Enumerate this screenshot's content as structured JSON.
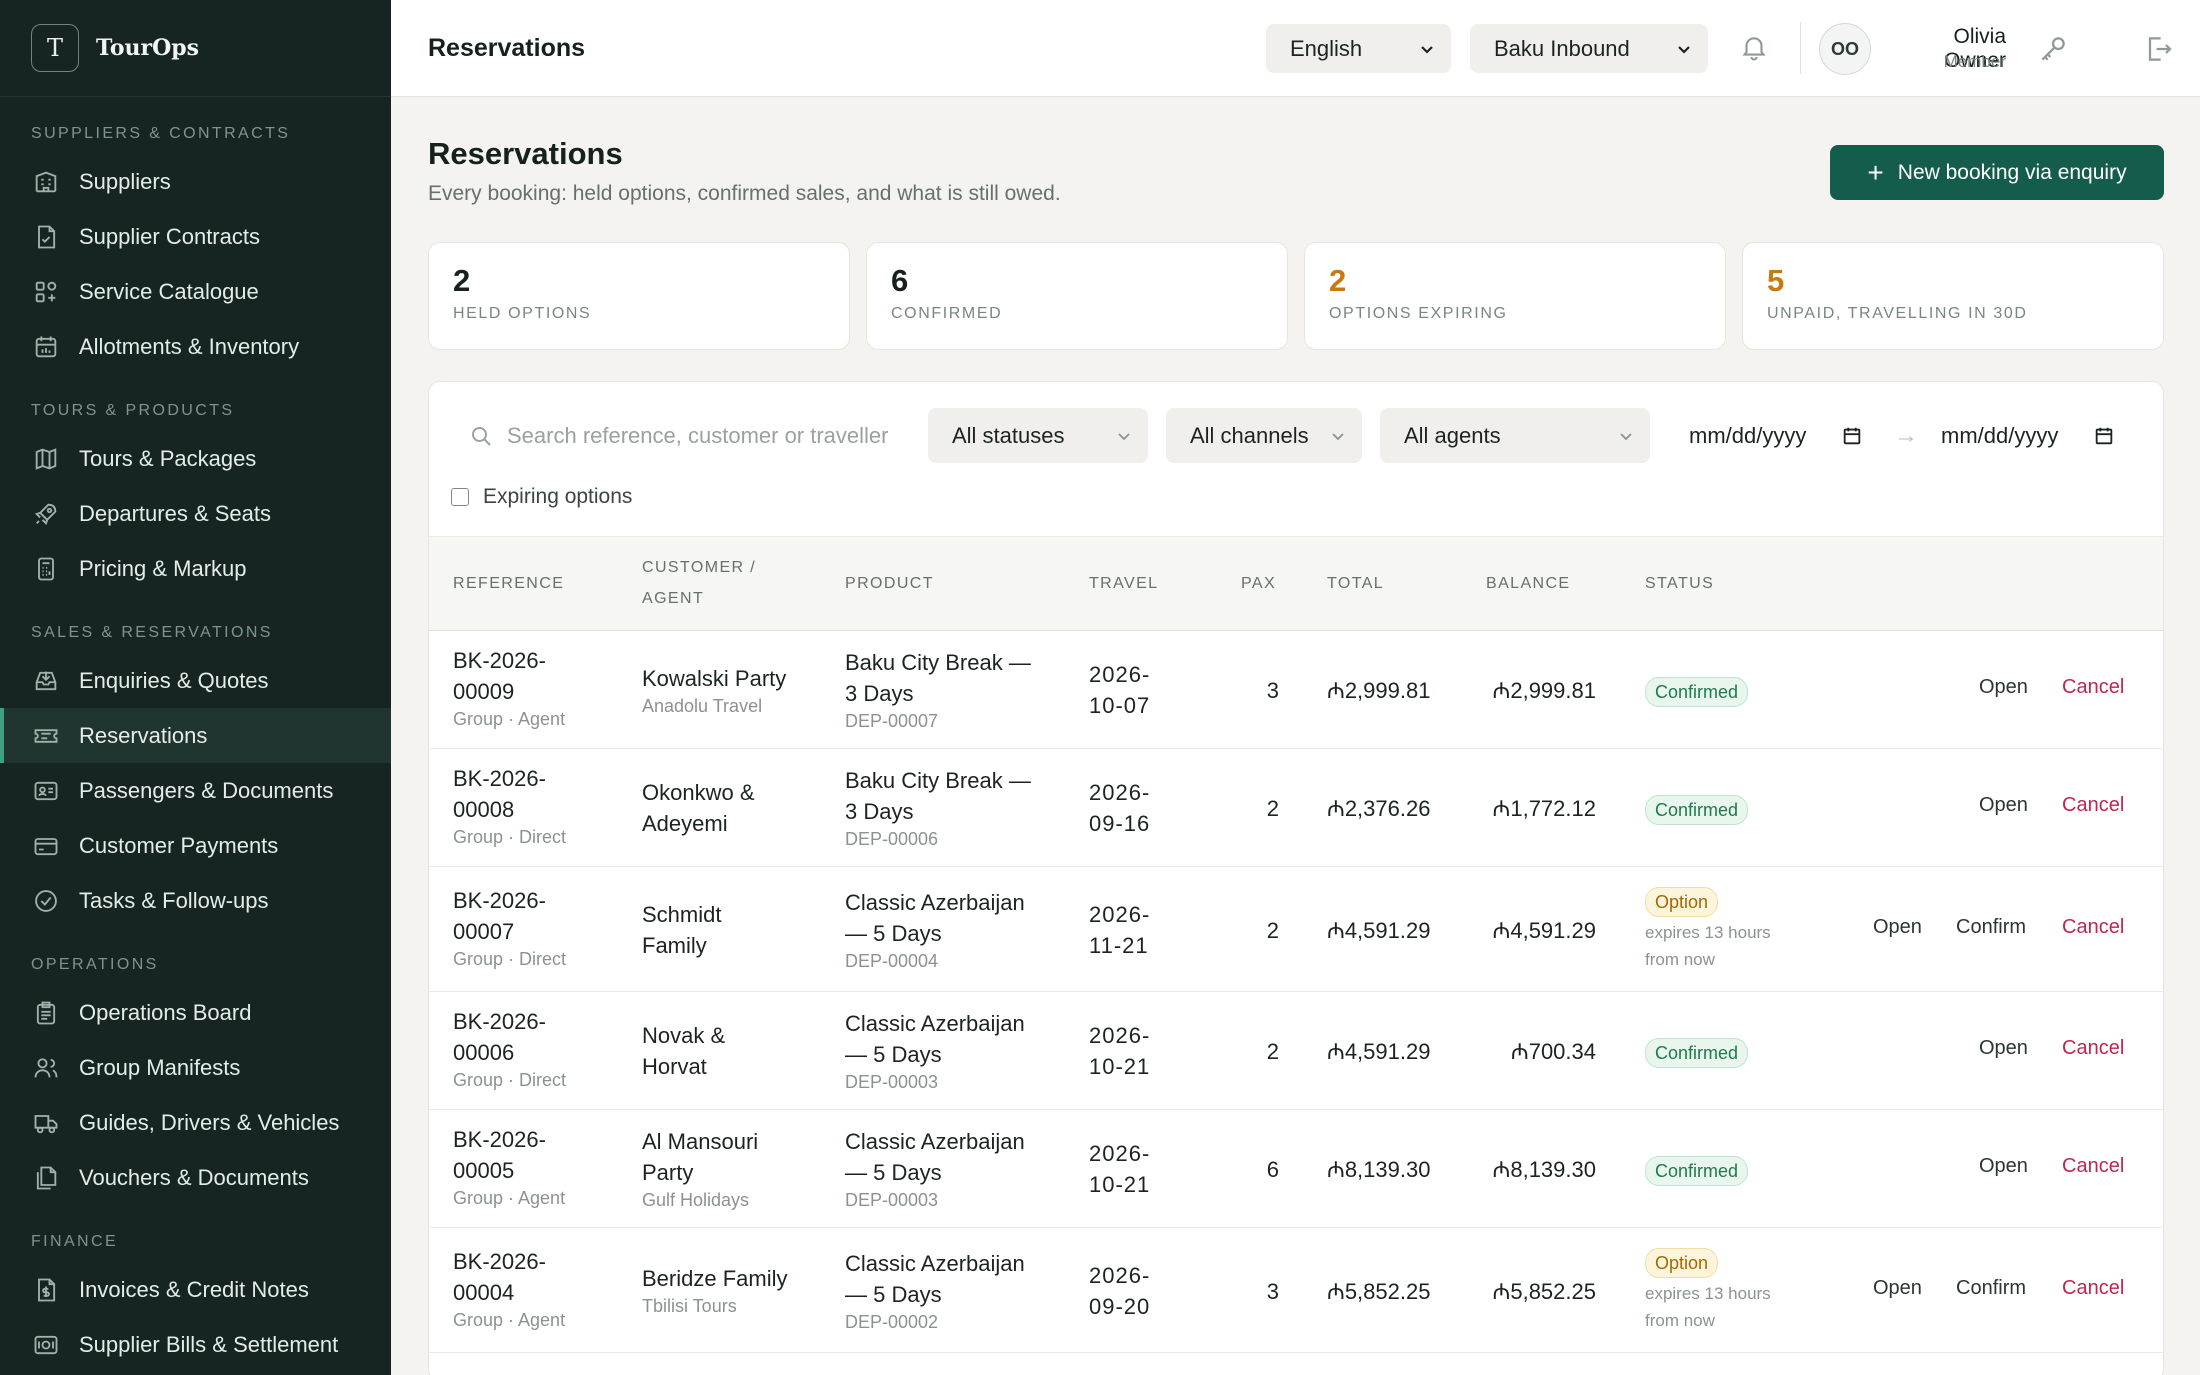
{
  "brand": {
    "logo_letter": "T",
    "name": "TourOps"
  },
  "sidebar": {
    "sections": [
      {
        "title": "SUPPLIERS & CONTRACTS",
        "items": [
          {
            "label": "Suppliers",
            "icon": "building-icon"
          },
          {
            "label": "Supplier Contracts",
            "icon": "contract-icon"
          },
          {
            "label": "Service Catalogue",
            "icon": "grid-icon"
          },
          {
            "label": "Allotments & Inventory",
            "icon": "calendar-icon"
          }
        ]
      },
      {
        "title": "TOURS & PRODUCTS",
        "items": [
          {
            "label": "Tours & Packages",
            "icon": "map-icon"
          },
          {
            "label": "Departures & Seats",
            "icon": "rocket-icon"
          },
          {
            "label": "Pricing & Markup",
            "icon": "calculator-icon"
          }
        ]
      },
      {
        "title": "SALES & RESERVATIONS",
        "items": [
          {
            "label": "Enquiries & Quotes",
            "icon": "inbox-icon"
          },
          {
            "label": "Reservations",
            "icon": "ticket-icon",
            "active": true
          },
          {
            "label": "Passengers & Documents",
            "icon": "id-card-icon"
          },
          {
            "label": "Customer Payments",
            "icon": "credit-card-icon"
          },
          {
            "label": "Tasks & Follow-ups",
            "icon": "check-circle-icon"
          }
        ]
      },
      {
        "title": "OPERATIONS",
        "items": [
          {
            "label": "Operations Board",
            "icon": "clipboard-icon"
          },
          {
            "label": "Group Manifests",
            "icon": "users-icon"
          },
          {
            "label": "Guides, Drivers & Vehicles",
            "icon": "truck-icon"
          },
          {
            "label": "Vouchers & Documents",
            "icon": "documents-icon"
          }
        ]
      },
      {
        "title": "FINANCE",
        "items": [
          {
            "label": "Invoices & Credit Notes",
            "icon": "invoice-icon"
          },
          {
            "label": "Supplier Bills & Settlement",
            "icon": "bill-icon"
          }
        ]
      }
    ]
  },
  "topbar": {
    "title": "Reservations",
    "language": "English",
    "agency": "Baku Inbound",
    "user": {
      "initials": "OO",
      "name": "Olivia Owner",
      "role": "Member"
    }
  },
  "page": {
    "heading": "Reservations",
    "subheading": "Every booking: held options, confirmed sales, and what is still owed.",
    "new_button": "New booking via enquiry"
  },
  "stats": [
    {
      "value": "2",
      "label": "HELD OPTIONS",
      "color": "#16211e"
    },
    {
      "value": "6",
      "label": "CONFIRMED",
      "color": "#16211e"
    },
    {
      "value": "2",
      "label": "OPTIONS EXPIRING",
      "color": "#c77a10"
    },
    {
      "value": "5",
      "label": "UNPAID, TRAVELLING IN 30D",
      "color": "#c77a10"
    }
  ],
  "filters": {
    "search_placeholder": "Search reference, customer or traveller",
    "status": "All statuses",
    "channel": "All channels",
    "agent": "All agents",
    "date_from": "mm/dd/yyyy",
    "date_to": "mm/dd/yyyy",
    "arrow": "→",
    "expiring_label": "Expiring options"
  },
  "table": {
    "headers": {
      "reference": "REFERENCE",
      "customer_1": "CUSTOMER /",
      "customer_2": "AGENT",
      "product": "PRODUCT",
      "travel": "TRAVEL",
      "pax": "PAX",
      "total": "TOTAL",
      "balance": "BALANCE",
      "status": "STATUS"
    },
    "actions": {
      "open": "Open",
      "confirm": "Confirm",
      "cancel": "Cancel"
    },
    "rows": [
      {
        "ref1": "BK-2026-",
        "ref2": "00009",
        "type": "Group · Agent",
        "cust1": "Kowalski Party",
        "cust2": "",
        "agent": "Anadolu Travel",
        "prod1": "Baku City Break —",
        "prod2": "3 Days",
        "dep": "DEP-00007",
        "travel1": "2026-",
        "travel2": "10-07",
        "pax": "3",
        "total": "₼2,999.81",
        "balance": "₼2,999.81",
        "status": "Confirmed",
        "expires1": "",
        "expires2": ""
      },
      {
        "ref1": "BK-2026-",
        "ref2": "00008",
        "type": "Group · Direct",
        "cust1": "Okonkwo &",
        "cust2": "Adeyemi",
        "agent": "",
        "prod1": "Baku City Break —",
        "prod2": "3 Days",
        "dep": "DEP-00006",
        "travel1": "2026-",
        "travel2": "09-16",
        "pax": "2",
        "total": "₼2,376.26",
        "balance": "₼1,772.12",
        "status": "Confirmed",
        "expires1": "",
        "expires2": ""
      },
      {
        "ref1": "BK-2026-",
        "ref2": "00007",
        "type": "Group · Direct",
        "cust1": "Schmidt",
        "cust2": "Family",
        "agent": "",
        "prod1": "Classic Azerbaijan",
        "prod2": "— 5 Days",
        "dep": "DEP-00004",
        "travel1": "2026-",
        "travel2": "11-21",
        "pax": "2",
        "total": "₼4,591.29",
        "balance": "₼4,591.29",
        "status": "Option",
        "expires1": "expires 13 hours",
        "expires2": "from now"
      },
      {
        "ref1": "BK-2026-",
        "ref2": "00006",
        "type": "Group · Direct",
        "cust1": "Novak &",
        "cust2": "Horvat",
        "agent": "",
        "prod1": "Classic Azerbaijan",
        "prod2": "— 5 Days",
        "dep": "DEP-00003",
        "travel1": "2026-",
        "travel2": "10-21",
        "pax": "2",
        "total": "₼4,591.29",
        "balance": "₼700.34",
        "status": "Confirmed",
        "expires1": "",
        "expires2": ""
      },
      {
        "ref1": "BK-2026-",
        "ref2": "00005",
        "type": "Group · Agent",
        "cust1": "Al Mansouri",
        "cust2": "Party",
        "agent": "Gulf Holidays",
        "prod1": "Classic Azerbaijan",
        "prod2": "— 5 Days",
        "dep": "DEP-00003",
        "travel1": "2026-",
        "travel2": "10-21",
        "pax": "6",
        "total": "₼8,139.30",
        "balance": "₼8,139.30",
        "status": "Confirmed",
        "expires1": "",
        "expires2": ""
      },
      {
        "ref1": "BK-2026-",
        "ref2": "00004",
        "type": "Group · Agent",
        "cust1": "Beridze Family",
        "cust2": "",
        "agent": "Tbilisi Tours",
        "prod1": "Classic Azerbaijan",
        "prod2": "— 5 Days",
        "dep": "DEP-00002",
        "travel1": "2026-",
        "travel2": "09-20",
        "pax": "3",
        "total": "₼5,852.25",
        "balance": "₼5,852.25",
        "status": "Option",
        "expires1": "expires 13 hours",
        "expires2": "from now"
      }
    ]
  }
}
